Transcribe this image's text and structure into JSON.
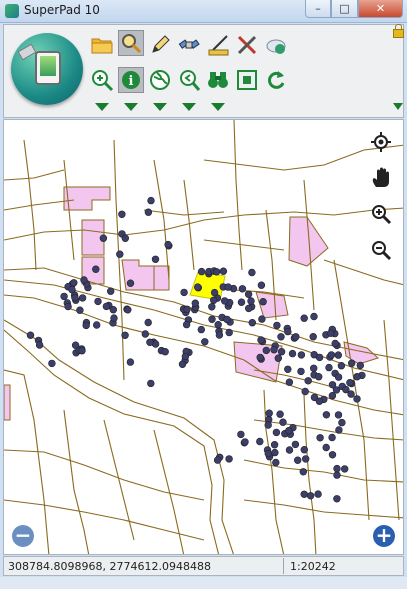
{
  "window": {
    "title": "SuperPad 10",
    "minimize_glyph": "–",
    "maximize_glyph": "□",
    "close_glyph": "✕"
  },
  "toolbar": {
    "row1": [
      {
        "name": "open-folder",
        "icon": "folder-icon"
      },
      {
        "name": "search-query",
        "icon": "magnifier-icon",
        "active": true
      },
      {
        "name": "edit-pencil",
        "icon": "pencil-icon"
      },
      {
        "name": "gps-satellite",
        "icon": "satellite-icon"
      },
      {
        "name": "measure",
        "icon": "ruler-icon"
      },
      {
        "name": "tools-settings",
        "icon": "tools-icon"
      },
      {
        "name": "cloud-sync",
        "icon": "cloud-icon"
      }
    ],
    "row2": [
      {
        "name": "zoom-in",
        "icon": "zoom-in-icon"
      },
      {
        "name": "identify-info",
        "icon": "info-icon",
        "active": true
      },
      {
        "name": "globe-layers",
        "icon": "globe-icon"
      },
      {
        "name": "zoom-previous",
        "icon": "zoom-back-icon"
      },
      {
        "name": "binoculars-find",
        "icon": "binoculars-icon"
      },
      {
        "name": "full-extent",
        "icon": "extent-icon"
      },
      {
        "name": "refresh",
        "icon": "refresh-icon"
      }
    ]
  },
  "map": {
    "colors": {
      "road": "#8b6a1f",
      "point": "#3d3f6b",
      "polygon_fill": "#f3c6ef",
      "polygon_stroke": "#8b6a1f",
      "selected_fill": "#ffff00"
    },
    "side_tools": [
      "locate-icon",
      "pan-hand-icon",
      "zoom-in-icon",
      "zoom-out-icon"
    ],
    "zoom_out_label": "−",
    "zoom_in_label": "+"
  },
  "status": {
    "coordinates": "308784.8098968, 2774612.0948488",
    "scale": "1:20242"
  }
}
